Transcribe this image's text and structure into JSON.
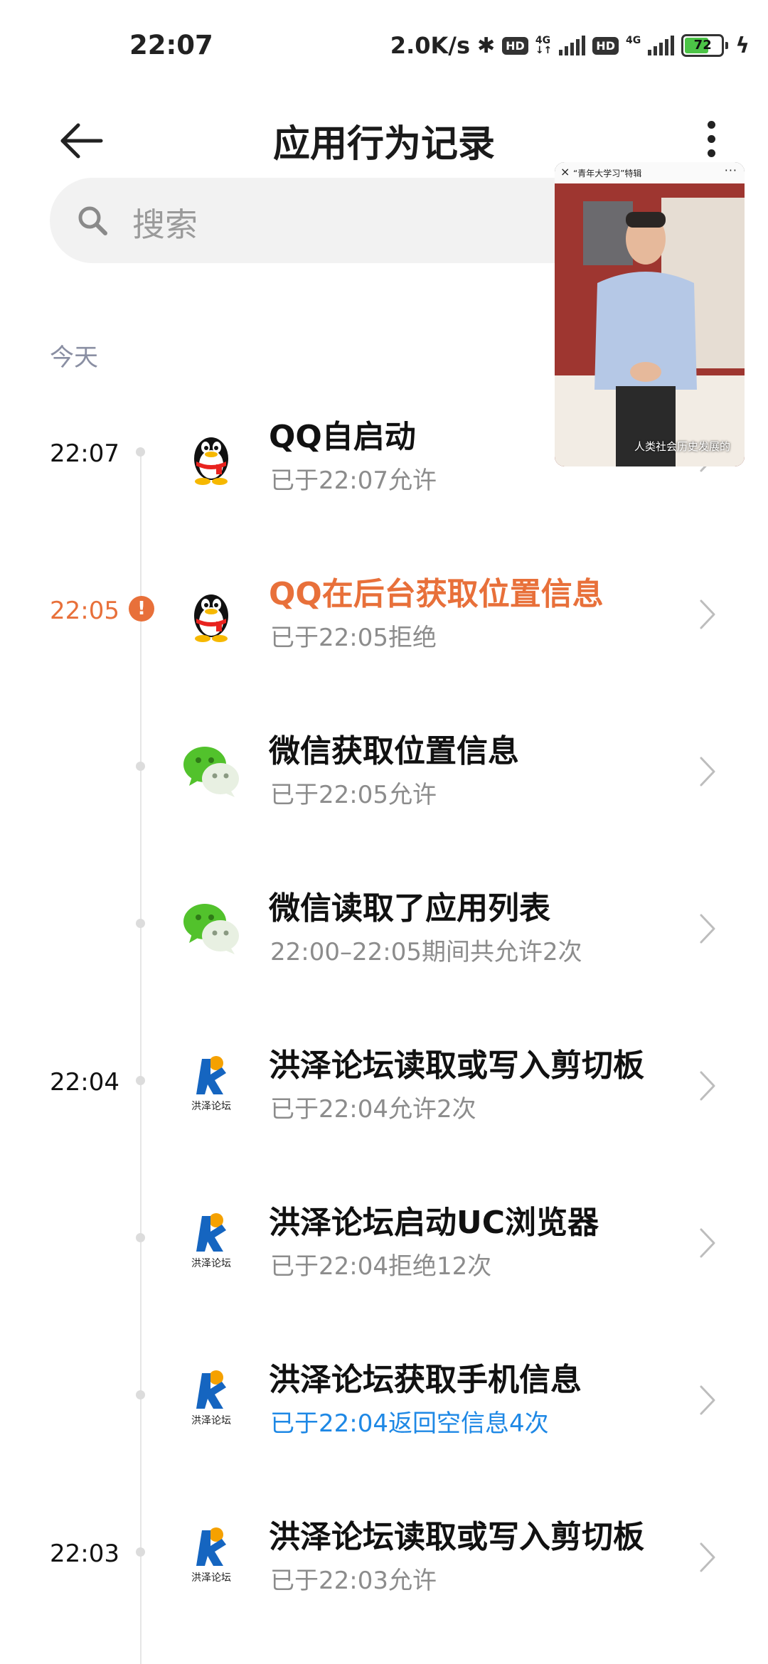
{
  "status_bar": {
    "time": "22:07",
    "net_speed": "2.0K/s",
    "hd1": "HD",
    "hd2": "HD",
    "sig1": "4G",
    "sig2": "4G",
    "battery": "72",
    "battery_level": 0.72
  },
  "header": {
    "title": "应用行为记录"
  },
  "search": {
    "placeholder": "搜索"
  },
  "section": {
    "label": "今天"
  },
  "records": [
    {
      "time": "22:07",
      "app": "QQ",
      "title": "QQ自启动",
      "subtitle": "已于22:07允许",
      "warn": false
    },
    {
      "time": "22:05",
      "app": "QQ",
      "title": "QQ在后台获取位置信息",
      "subtitle": "已于22:05拒绝",
      "warn": true
    },
    {
      "time": "",
      "app": "WeChat",
      "title": "微信获取位置信息",
      "subtitle": "已于22:05允许",
      "warn": false
    },
    {
      "time": "",
      "app": "WeChat",
      "title": "微信读取了应用列表",
      "subtitle": "22:00–22:05期间共允许2次",
      "warn": false
    },
    {
      "time": "22:04",
      "app": "洪泽论坛",
      "title": "洪泽论坛读取或写入剪切板",
      "subtitle": "已于22:04允许2次",
      "warn": false
    },
    {
      "time": "",
      "app": "洪泽论坛",
      "title": "洪泽论坛启动UC浏览器",
      "subtitle": "已于22:04拒绝12次",
      "warn": false
    },
    {
      "time": "",
      "app": "洪泽论坛",
      "title": "洪泽论坛获取手机信息",
      "subtitle": "已于22:04返回空信息4次",
      "warn": false,
      "subtitle_color": "#1e88e5"
    },
    {
      "time": "22:03",
      "app": "洪泽论坛",
      "title": "洪泽论坛读取或写入剪切板",
      "subtitle": "已于22:03允许",
      "warn": false
    }
  ],
  "forum_icon_label": "洪泽论坛",
  "pip": {
    "title": "“青年大学习”特辑",
    "caption": "人类社会历史发展的"
  },
  "colors": {
    "warning": "#e8703a",
    "info": "#1e88e5",
    "wechat": "#52c22c"
  }
}
